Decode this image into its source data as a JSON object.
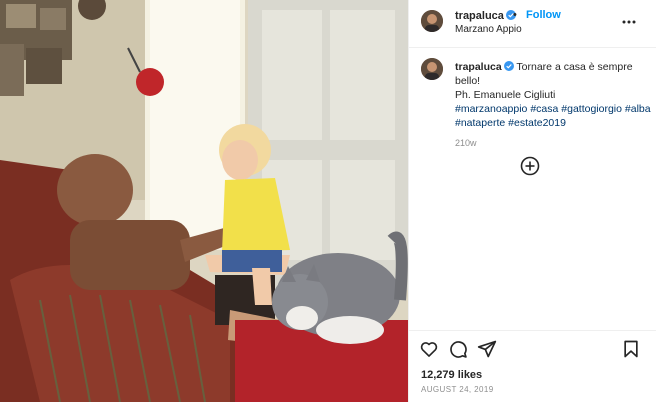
{
  "post": {
    "image_alt": "Man in armchair with child and grey-white cat"
  },
  "header": {
    "username": "trapaluca",
    "verified_icon": "verified-badge-icon",
    "separator": "•",
    "follow_label": "Follow",
    "location": "Marzano Appio",
    "more_icon": "more-options-icon"
  },
  "caption": {
    "username": "trapaluca",
    "text": "Tornare a casa è sempre bello!",
    "credit": "Ph. Emanuele Cigliuti",
    "hashtags": [
      "#marzanoappio",
      "#casa",
      "#gattogiorgio",
      "#alba",
      "#nataperte",
      "#estate2019"
    ],
    "time": "210w"
  },
  "comments": {
    "load_more_icon": "plus-circle-icon"
  },
  "actions": {
    "like_icon": "heart-icon",
    "comment_icon": "comment-icon",
    "share_icon": "share-icon",
    "save_icon": "bookmark-icon",
    "likes": "12,279 likes",
    "date": "AUGUST 24, 2019"
  },
  "colors": {
    "link": "#0095f6",
    "hashtag": "#00376b",
    "muted": "#8e8e8e"
  }
}
